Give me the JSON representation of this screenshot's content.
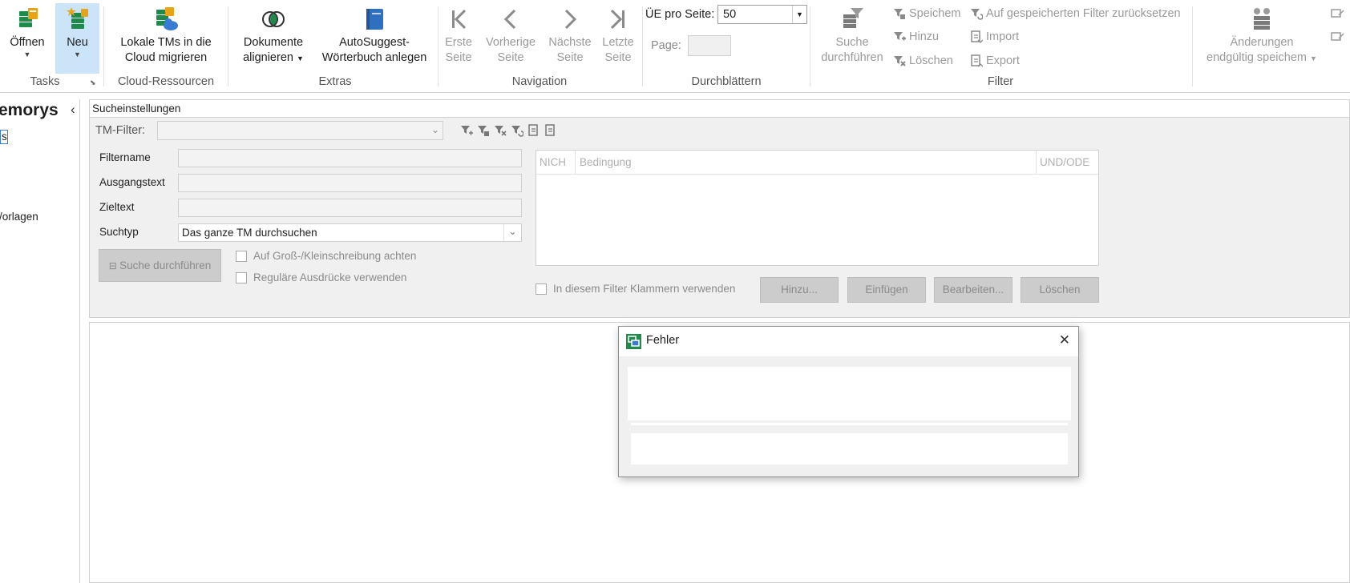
{
  "ribbon": {
    "tasks": {
      "label": "Tasks",
      "open_label": "Öffnen",
      "new_label": "Neu"
    },
    "cloud": {
      "label": "Cloud-Ressourcen",
      "migrate_line1": "Lokale TMs in die",
      "migrate_line2": "Cloud migrieren"
    },
    "extras": {
      "label": "Extras",
      "align_line1": "Dokumente",
      "align_line2": "alignieren",
      "autosuggest_line1": "AutoSuggest-",
      "autosuggest_line2": "Wörterbuch anlegen"
    },
    "navigation": {
      "label": "Navigation",
      "first_line1": "Erste",
      "first_line2": "Seite",
      "prev_line1": "Vorherige",
      "prev_line2": "Seite",
      "next_line1": "Nächste",
      "next_line2": "Seite",
      "last_line1": "Letzte",
      "last_line2": "Seite"
    },
    "browse": {
      "label": "Durchblättern",
      "per_page_label": "ÜE pro Seite:",
      "per_page_value": "50",
      "page_label": "Page:"
    },
    "filter": {
      "label": "Filter",
      "search_line1": "Suche",
      "search_line2": "durchführen",
      "save": "Speichem",
      "add": "Hinzu",
      "delete": "Löschen",
      "reset": "Auf gespeicherten Filter zurücksetzen",
      "import": "Import",
      "export": "Export"
    },
    "commit": {
      "line1": "Änderungen",
      "line2": "endgültig speichem"
    }
  },
  "left_panel": {
    "title": "emorys",
    "collapse_glyph": "‹",
    "selected_item": "s",
    "item_templates": "/orlagen"
  },
  "search": {
    "header": "Sucheinstellungen",
    "tm_filter_label": "TM-Filter:",
    "filtername_label": "Filtername",
    "source_label": "Ausgangstext",
    "target_label": "Zieltext",
    "searchtype_label": "Suchtyp",
    "searchtype_value": "Das ganze TM durchsuchen",
    "search_button": "Suche durchführen",
    "case_check": "Auf Groß-/Kleinschreibung achten",
    "regex_check": "Reguläre Ausdrücke verwenden",
    "conditions": {
      "col_not": "NICH",
      "col_condition": "Bedingung",
      "col_andor": "UND/ODE"
    },
    "brackets_check": "In diesem Filter Klammern verwenden",
    "btn_add": "Hinzu...",
    "btn_insert": "Einfügen",
    "btn_edit": "Bearbeiten...",
    "btn_delete": "Löschen"
  },
  "dialog": {
    "title": "Fehler",
    "close_glyph": "✕"
  },
  "colors": {
    "accent_blue": "#3a7bd5",
    "selection_blue": "#cce4f7",
    "disabled_text": "#9a9a9a",
    "icon_green": "#1f8a4c",
    "icon_orange": "#e8a317"
  }
}
